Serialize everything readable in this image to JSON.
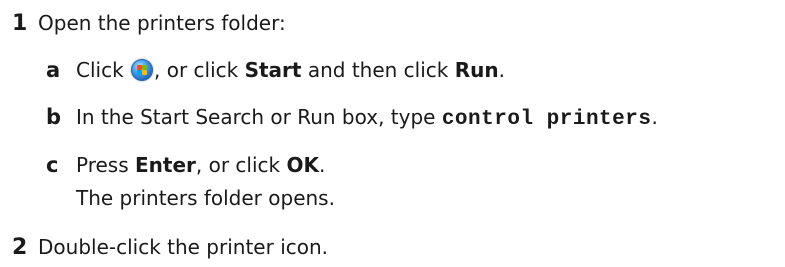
{
  "steps": [
    {
      "number": "1",
      "text": "Open the printers folder:",
      "substeps": [
        {
          "letter": "a",
          "part1": "Click ",
          "icon": "windows-start-orb-icon",
          "part2": ", or click ",
          "bold1": "Start",
          "part3": " and then click ",
          "bold2": "Run",
          "part4": "."
        },
        {
          "letter": "b",
          "part1": "In the Start Search or Run box, type ",
          "code": "control printers",
          "part2": "."
        },
        {
          "letter": "c",
          "part1": "Press ",
          "bold1": "Enter",
          "part2": ", or click ",
          "bold2": "OK",
          "part3": ".",
          "result": "The printers folder opens."
        }
      ]
    },
    {
      "number": "2",
      "text": "Double-click the printer icon."
    }
  ]
}
